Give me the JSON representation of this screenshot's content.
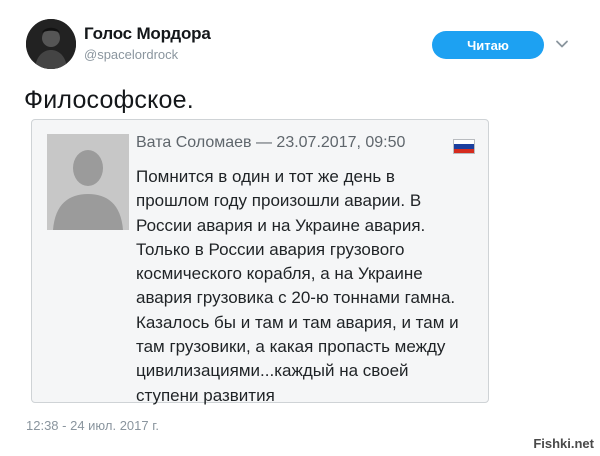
{
  "header": {
    "display_name": "Голос Мордора",
    "handle": "@spacelordrock",
    "follow_button": "Читаю",
    "menu_icon": "chevron-down-icon",
    "avatar_icon": "profile-photo"
  },
  "tweet": {
    "text": "Философское.",
    "timestamp": "12:38 - 24 июл. 2017 г."
  },
  "embedded_comment": {
    "avatar_icon": "default-user-silhouette",
    "header": "Вата Соломаев — 23.07.2017, 09:50",
    "flag_icon": "russian-flag-icon",
    "flag_colors": [
      "#ffffff",
      "#1c3f9e",
      "#d52b1e"
    ],
    "body_lines": [
      "Помнится в один и тот же день в",
      "прошлом году произошли аварии. В",
      "России авария и на Украине авария.",
      "Только в России авария грузового",
      "космического корабля, а на Украине",
      "авария грузовика с 20-ю тоннами гамна.",
      "Казалось бы и там и там авария, и там и",
      "там грузовики, а какая пропасть между",
      "цивилизациями...каждый на своей",
      "ступени развития"
    ]
  },
  "watermark": "Fishki.net",
  "colors": {
    "accent": "#1da1f2",
    "muted": "#8a959e"
  }
}
